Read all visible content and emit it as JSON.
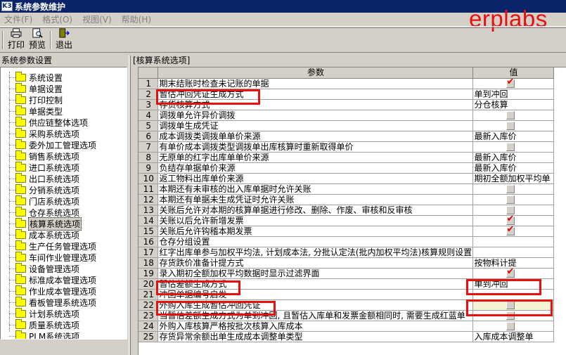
{
  "window": {
    "title": "系统参数维护",
    "icon_label": "K3"
  },
  "brand": "erplabs",
  "menu": [
    "文件(F)",
    "格式(O)",
    "视图(V)",
    "帮助(H)"
  ],
  "toolbar": {
    "print_label": "打印",
    "preview_label": "预览",
    "exit_label": "退出"
  },
  "left_panel": {
    "title": "系统参数设置",
    "items": [
      "系统设置",
      "单据设置",
      "打印控制",
      "单据类型",
      "供应链整体选项",
      "采购系统选项",
      "委外加工管理选项",
      "销售系统选项",
      "进口系统选项",
      "出口系统选项",
      "分销系统选项",
      "门店系统选项",
      "仓存系统选项",
      "核算系统选项",
      "成本系统选项",
      "生产任务管理选项",
      "车间作业管理选项",
      "设备管理选项",
      "标准成本管理选项",
      "作业成本管理选项",
      "看板管理系统选项",
      "计划系统选项",
      "质量系统选项",
      "PLM系统选项"
    ],
    "selected_index": 13
  },
  "right_panel": {
    "title": "[核算系统选项]",
    "columns": {
      "param": "参数",
      "value": "值"
    },
    "rows": [
      {
        "num": "1",
        "param": "期末结账时检查未记账的单据",
        "type": "check",
        "checked": true
      },
      {
        "num": "2",
        "param": "暂估冲回凭证生成方式",
        "type": "text",
        "value": "单到冲回"
      },
      {
        "num": "3",
        "param": "存货核算方式",
        "type": "text",
        "value": "分仓核算"
      },
      {
        "num": "4",
        "param": "调拨单允许异价调拨",
        "type": "check",
        "checked": false
      },
      {
        "num": "5",
        "param": "调拨单生成凭证",
        "type": "check",
        "checked": false
      },
      {
        "num": "6",
        "param": "成本调拨类调拨单单价来源",
        "type": "text",
        "value": "最新入库价"
      },
      {
        "num": "7",
        "param": "有单价成本调拨类型调拨单出库核算时重新取得单价",
        "type": "check",
        "checked": false
      },
      {
        "num": "8",
        "param": "无原单的红字出库单单价来源",
        "type": "text",
        "value": "最新入库价"
      },
      {
        "num": "9",
        "param": "负结存单据单价来源",
        "type": "text",
        "value": "最新入库价"
      },
      {
        "num": "10",
        "param": "返工物料出库单价来源",
        "type": "text",
        "value": "期初全额加权平均单"
      },
      {
        "num": "11",
        "param": "本期还有未审核的出入库单据时允许关账",
        "type": "check",
        "checked": false
      },
      {
        "num": "12",
        "param": "本期还有单据未生成凭证时允许关账",
        "type": "check",
        "checked": false
      },
      {
        "num": "13",
        "param": "关账后允许对本期的核算单据进行修改、删除、作废、审核和反审核",
        "type": "check",
        "checked": false
      },
      {
        "num": "14",
        "param": "关账以后允许新增发票",
        "type": "check",
        "checked": true
      },
      {
        "num": "15",
        "param": "关账后允许钩稽本期发票",
        "type": "check",
        "checked": true
      },
      {
        "num": "16",
        "param": "仓存分组设置",
        "type": "none"
      },
      {
        "num": "17",
        "param": "红字出库单参与加权平均法, 计划成本法, 分批认定法(批内加权平均法)核算规则设置",
        "type": "none"
      },
      {
        "num": "18",
        "param": "存货跌价准备计提方式",
        "type": "text",
        "value": "按物料计提"
      },
      {
        "num": "19",
        "param": "录入期初全额加权平均数据时显示过滤界面",
        "type": "check",
        "checked": true
      },
      {
        "num": "20",
        "param": "暂估差额生成方式",
        "type": "text",
        "value": "单到冲回"
      },
      {
        "num": "21",
        "param": "冲回单据编号启发",
        "type": "none"
      },
      {
        "num": "22",
        "param": "外购入库生成暂估冲回凭证",
        "type": "check",
        "checked": false,
        "highlight": true
      },
      {
        "num": "23",
        "param": "当暂估差额生成方式为单到冲回, 且暂估入库单和发票金额相同时, 需要生成红蓝单",
        "type": "check",
        "checked": false
      },
      {
        "num": "24",
        "param": "外购入库核算严格按批次核算入库成本",
        "type": "check",
        "checked": false
      },
      {
        "num": "25",
        "param": "存货异常余额出单生成成本调整单类型",
        "type": "text",
        "value": "入库成本调整单"
      }
    ]
  },
  "colors": {
    "titlebar": "#0a246a",
    "annotation_red": "#e8100f",
    "check_red": "#e00000"
  }
}
